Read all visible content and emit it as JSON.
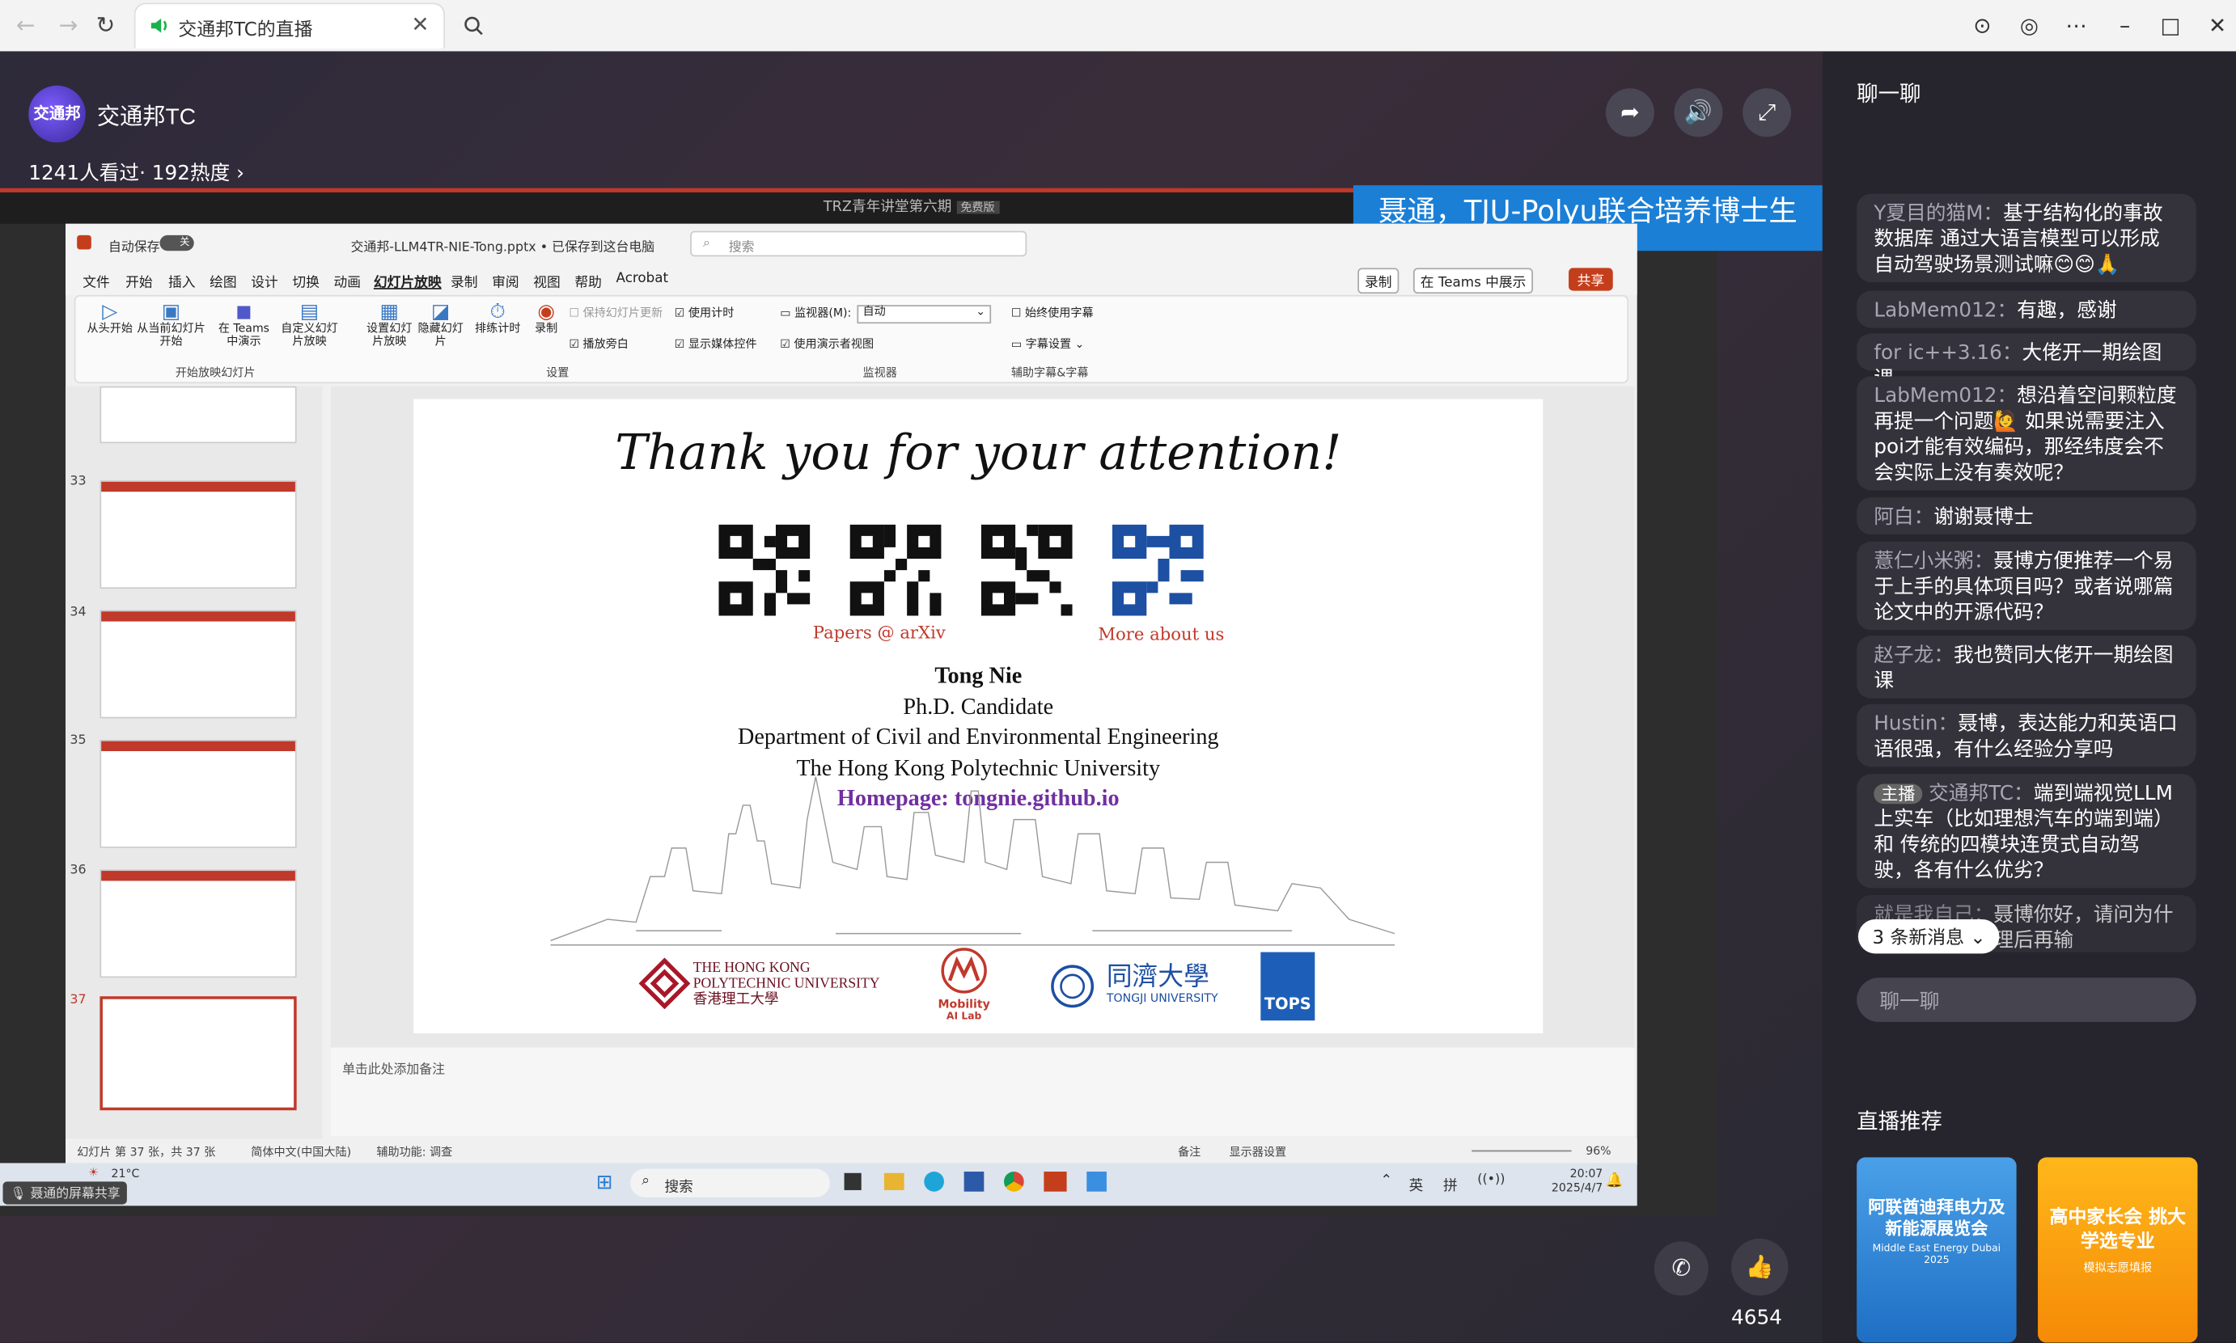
{
  "browser": {
    "tab_title": "交通邦TC的直播",
    "close_symbol": "✕"
  },
  "stream": {
    "channel_name": "交通邦TC",
    "avatar_text": "交通邦",
    "viewers": "1241人看过· 192热度",
    "banner": "聂通，TJU-Polyu联合培养博士生",
    "share_notice": "聂通的屏幕共享",
    "like_count": "4654"
  },
  "shared": {
    "window_title": "TRZ青年讲堂第六期",
    "window_badge": "免费版"
  },
  "ppt": {
    "autosave": "自动保存",
    "autosave_toggle": "关",
    "file_name": "交通邦-LLM4TR-NIE-Tong.pptx • 已保存到这台电脑",
    "search": "搜索",
    "menu": [
      "文件",
      "开始",
      "插入",
      "绘图",
      "设计",
      "切换",
      "动画",
      "幻灯片放映",
      "录制",
      "审阅",
      "视图",
      "帮助",
      "Acrobat"
    ],
    "record_btn": "录制",
    "teams_btn": "在 Teams 中展示",
    "share_btn": "共享",
    "ribbon": {
      "from_start": "从头开始",
      "from_current": "从当前幻灯片开始",
      "teams": "在 Teams 中演示",
      "custom": "自定义幻灯片放映",
      "setup": "设置幻灯片放映",
      "hide": "隐藏幻灯片",
      "rehearse": "排练计时",
      "record": "录制",
      "keep_fresh": "保持幻灯片更新",
      "narration": "播放旁白",
      "use_timing": "使用计时",
      "show_media": "显示媒体控件",
      "monitor": "监视器(M):",
      "monitor_val": "自动",
      "presenter_view": "使用演示者视图",
      "always_subtitle": "始终使用字幕",
      "subtitle_settings": "字幕设置",
      "group_start": "开始放映幻灯片",
      "group_setup": "设置",
      "group_monitor": "监视器",
      "group_caption": "辅助字幕&字幕"
    },
    "thumb_numbers": [
      "33",
      "34",
      "35",
      "36",
      "37"
    ],
    "notes_placeholder": "单击此处添加备注",
    "status": {
      "slide_count": "幻灯片 第 37 张，共 37 张",
      "lang": "简体中文(中国大陆)",
      "access": "辅助功能: 调查",
      "notes": "备注",
      "display": "显示器设置",
      "zoom": "96%"
    }
  },
  "slide": {
    "title": "Thank you for your attention!",
    "qr_left_caption": "Papers @ arXiv",
    "qr_right_caption": "More about us",
    "name": "Tong Nie",
    "role": "Ph.D. Candidate",
    "dept": "Department of Civil and Environmental Engineering",
    "univ": "The Hong Kong Polytechnic University",
    "homepage": "Homepage: tongnie.github.io",
    "logo_polyu_1": "THE HONG KONG",
    "logo_polyu_2": "POLYTECHNIC UNIVERSITY",
    "logo_polyu_3": "香港理工大學",
    "logo_mobility": "Mobility",
    "logo_mobility_2": "AI Lab",
    "logo_tongji": "同濟大學",
    "logo_tongji_2": "TONGJI UNIVERSITY",
    "logo_tops": "TOPS"
  },
  "taskbar": {
    "weather": "21°C",
    "search": "搜索",
    "ime1": "英",
    "ime2": "拼",
    "time": "20:07",
    "date": "2025/4/7"
  },
  "chat": {
    "title": "聊一聊",
    "messages": [
      {
        "user": "Y夏目的猫M：",
        "text": "基于结构化的事故数据库 通过大语言模型可以形成自动驾驶场景测试嘛😊😊🙏"
      },
      {
        "user": "LabMem012：",
        "text": "有趣，感谢"
      },
      {
        "user": "for ic++3.16：",
        "text": "大佬开一期绘图课"
      },
      {
        "user": "LabMem012：",
        "text": "想沿着空间颗粒度再提一个问题🙋 如果说需要注入poi才能有效编码，那经纬度会不会实际上没有奏效呢？"
      },
      {
        "user": "阿白：",
        "text": "谢谢聂博士"
      },
      {
        "user": "薏仁小米粥：",
        "text": "聂博方便推荐一个易于上手的具体项目吗？或者说哪篇论文中的开源代码？"
      },
      {
        "user": "赵子龙：",
        "text": "我也赞同大佬开一期绘图课"
      },
      {
        "user": "Hustin：",
        "text": "聂博，表达能力和英语口语很强，有什么经验分享吗"
      },
      {
        "user": "交通邦TC：",
        "text": "端到端视觉LLM上实车（比如理想汽车的端到端）和 传统的四模块连贯式自动驾驶，各有什么优劣？",
        "badge": "主播"
      },
      {
        "user": "就是我自己：",
        "text": "聂博你好，请问为什么…理信息处理后再输"
      }
    ],
    "new_msgs": "3 条新消息",
    "input_placeholder": "聊一聊",
    "recommend_title": "直播推荐",
    "rec1_title": "阿联酋迪拜电力及新能源展览会",
    "rec1_sub": "Middle East Energy Dubai 2025",
    "rec2_title": "高中家长会 挑大学选专业",
    "rec2_sub": "模拟志愿填报"
  },
  "colors": {
    "accent": "#c0392b",
    "banner_blue": "#1b7fd6",
    "homepage_purple": "#7030a0",
    "caption_red": "#c0392b"
  }
}
